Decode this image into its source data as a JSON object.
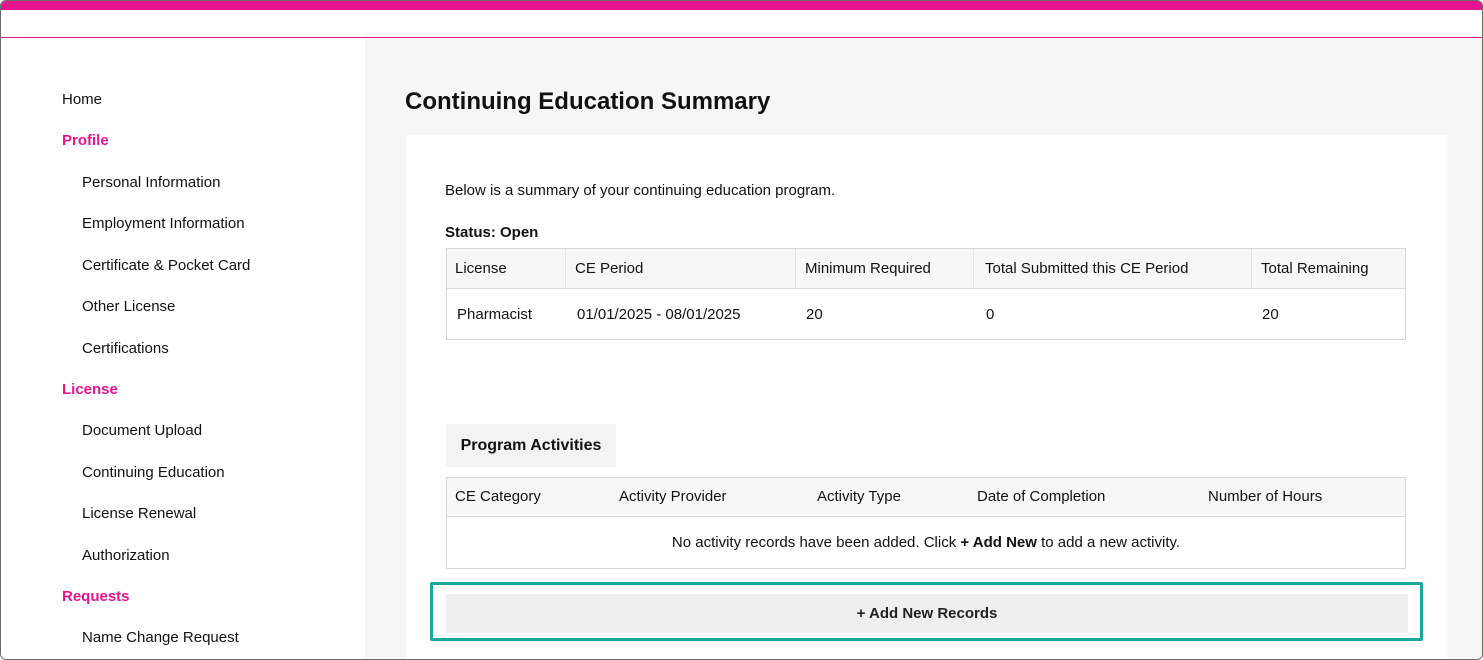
{
  "sidebar": {
    "home": "Home",
    "profile_section": "Profile",
    "profile_items": [
      "Personal Information",
      "Employment Information",
      "Certificate & Pocket Card",
      "Other License",
      "Certifications"
    ],
    "license_section": "License",
    "license_items": [
      "Document Upload",
      "Continuing Education",
      "License Renewal",
      "Authorization"
    ],
    "requests_section": "Requests",
    "requests_items": [
      "Name Change Request"
    ]
  },
  "main": {
    "title": "Continuing Education Summary",
    "intro": "Below is a summary of your continuing education program.",
    "status_label": "Status: Open",
    "summary_table": {
      "headers": [
        "License",
        "CE Period",
        "Minimum Required",
        "Total Submitted this CE Period",
        "Total Remaining"
      ],
      "row": [
        "Pharmacist",
        "01/01/2025 - 08/01/2025",
        "20",
        "0",
        "20"
      ]
    },
    "program_activities_label": "Program Activities",
    "activities_table": {
      "headers": [
        "CE Category",
        "Activity Provider",
        "Activity Type",
        "Date of Completion",
        "Number of Hours"
      ],
      "empty_prefix": "No activity records have been added. Click ",
      "empty_bold": "+ Add New",
      "empty_suffix": " to add a new activity."
    },
    "add_button": "+ Add New Records"
  },
  "colors": {
    "accent": "#e6158f",
    "highlight": "#1aa89a"
  }
}
